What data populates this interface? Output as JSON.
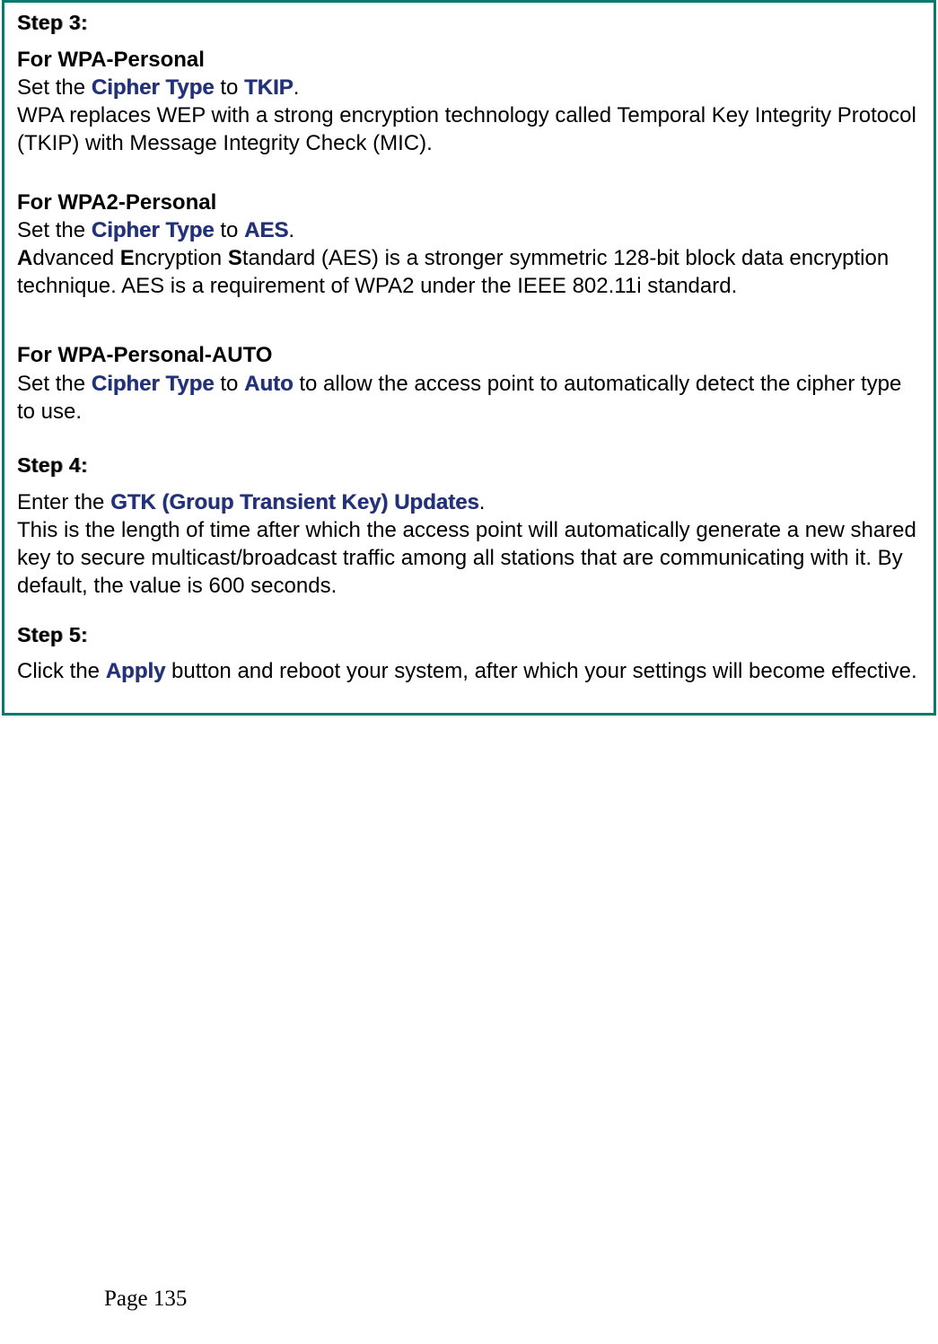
{
  "step3": {
    "label": "Step 3:",
    "wpa_personal": {
      "heading": "For WPA-Personal",
      "line1_prefix": "Set the ",
      "line1_kw": "Cipher Type",
      "line1_mid": " to ",
      "line1_term": "TKIP",
      "line1_suffix": ".",
      "desc": "WPA replaces WEP with a strong encryption technology called Temporal Key Integrity Protocol (TKIP) with Message Integrity Check (MIC)."
    },
    "wpa2_personal": {
      "heading": "For WPA2-Personal",
      "line1_prefix": "Set the ",
      "line1_kw": "Cipher Type",
      "line1_mid": " to ",
      "line1_term": "AES",
      "line1_suffix": ".",
      "desc_a": "A",
      "desc_b": "dvanced ",
      "desc_c": "E",
      "desc_d": "ncryption ",
      "desc_e": "S",
      "desc_f": "tandard (AES) is a stronger symmetric 128-bit block data encryption technique. AES is a requirement of WPA2 under the IEEE 802.11i standard."
    },
    "wpa_personal_auto": {
      "heading": "For WPA-Personal-AUTO",
      "line1_prefix": "Set the ",
      "line1_kw": "Cipher Type",
      "line1_mid": " to ",
      "line1_term": "Auto",
      "line1_suffix": " to allow the access point to automatically detect the cipher type to use."
    }
  },
  "step4": {
    "label": "Step 4:",
    "line1_prefix": "Enter the ",
    "line1_term": "GTK (Group Transient Key) Updates",
    "line1_suffix": ".",
    "desc": "This is the length of time after which the access point will automatically generate a new shared key to secure multicast/broadcast traffic among all stations that are communicating with it. By default, the value is 600 seconds."
  },
  "step5": {
    "label": "Step 5:",
    "line1_prefix": "Click the ",
    "line1_term": "Apply",
    "line1_suffix": " button and reboot your system, after which your settings will become effective."
  },
  "footer": {
    "page": "Page 135"
  }
}
